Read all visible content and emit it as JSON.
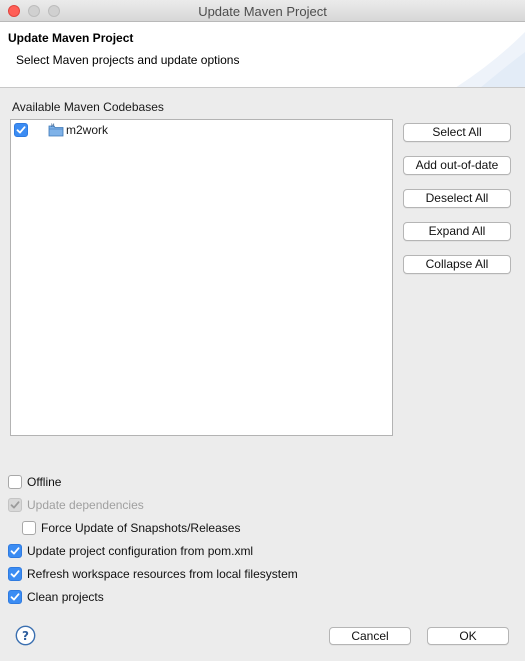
{
  "window": {
    "title": "Update Maven Project"
  },
  "header": {
    "title": "Update Maven Project",
    "description": "Select Maven projects and update options"
  },
  "codebases": {
    "label": "Available Maven Codebases",
    "items": [
      {
        "label": "m2work",
        "checked": true,
        "icon": "maven-folder-icon"
      }
    ]
  },
  "side_buttons": {
    "select_all": "Select All",
    "add_out_of_date": "Add out-of-date",
    "deselect_all": "Deselect All",
    "expand_all": "Expand All",
    "collapse_all": "Collapse All"
  },
  "options": {
    "offline": {
      "label": "Offline",
      "checked": false,
      "enabled": true
    },
    "update_dependencies": {
      "label": "Update dependencies",
      "checked": true,
      "enabled": false
    },
    "force_update": {
      "label": "Force Update of Snapshots/Releases",
      "checked": false,
      "enabled": true
    },
    "update_config": {
      "label": "Update project configuration from pom.xml",
      "checked": true,
      "enabled": true
    },
    "refresh_workspace": {
      "label": "Refresh workspace resources from local filesystem",
      "checked": true,
      "enabled": true
    },
    "clean_projects": {
      "label": "Clean projects",
      "checked": true,
      "enabled": true
    }
  },
  "footer": {
    "help_icon": "help-icon",
    "cancel_label": "Cancel",
    "ok_label": "OK"
  },
  "colors": {
    "checkbox_accent": "#3b8cf3",
    "header_bg": "#ffffff",
    "window_bg": "#ececec"
  }
}
